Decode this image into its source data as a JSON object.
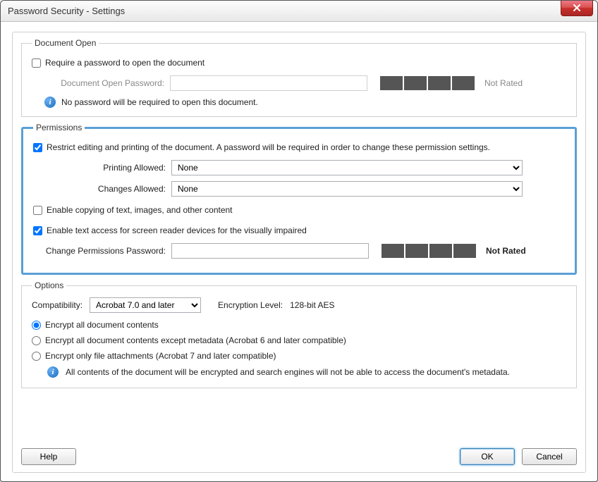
{
  "window": {
    "title": "Password Security - Settings"
  },
  "docopen": {
    "legend": "Document Open",
    "require_label": "Require a password to open the document",
    "pw_label": "Document Open Password:",
    "info_text": "No password will be required to open this document.",
    "strength_text": "Not Rated"
  },
  "perm": {
    "legend": "Permissions",
    "restrict_label": "Restrict editing and printing of the document. A password will be required in order to change these permission settings.",
    "printing_label": "Printing Allowed:",
    "printing_value": "None",
    "changes_label": "Changes Allowed:",
    "changes_value": "None",
    "copy_label": "Enable copying of text, images, and other content",
    "reader_label": "Enable text access for screen reader devices for the visually impaired",
    "pw_label": "Change Permissions Password:",
    "strength_text": "Not Rated"
  },
  "options": {
    "legend": "Options",
    "compat_label": "Compatibility:",
    "compat_value": "Acrobat 7.0 and later",
    "enc_level_label": "Encryption Level:",
    "enc_level_value": "128-bit AES",
    "r1": "Encrypt all document contents",
    "r2": "Encrypt all document contents except metadata (Acrobat 6 and later compatible)",
    "r3": "Encrypt only file attachments (Acrobat 7 and later compatible)",
    "info_text": "All contents of the document will be encrypted and search engines will not be able to access the document's metadata."
  },
  "buttons": {
    "help": "Help",
    "ok": "OK",
    "cancel": "Cancel"
  }
}
